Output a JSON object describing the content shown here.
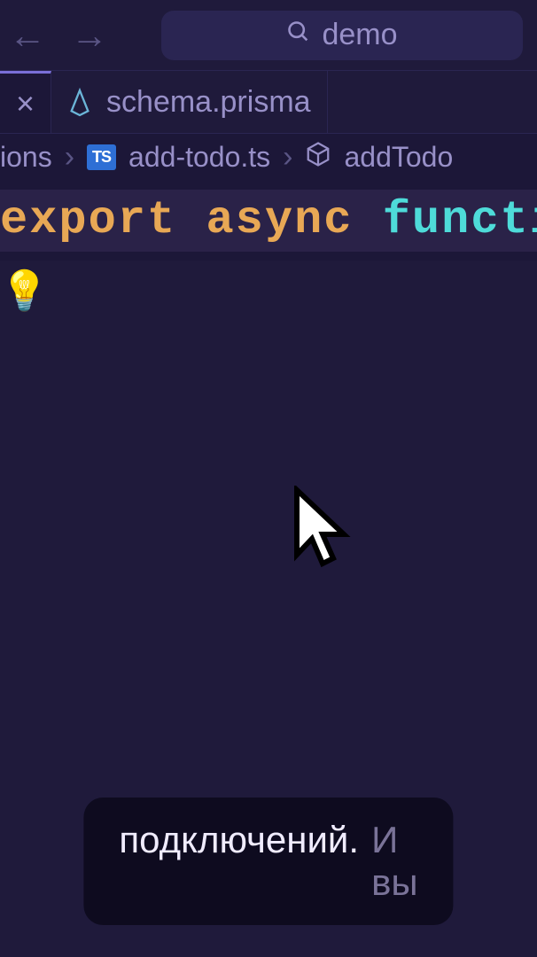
{
  "topbar": {
    "search_text": "demo"
  },
  "tabs": {
    "schema_label": "schema.prisma"
  },
  "breadcrumb": {
    "seg0": "ions",
    "seg1": "add-todo.ts",
    "seg2": "addTodo",
    "ts_badge": "TS"
  },
  "code": {
    "kw_export": "export",
    "kw_async": "async",
    "kw_function": "functio"
  },
  "caption": {
    "word1": "подключений.",
    "word2": "И вы"
  }
}
